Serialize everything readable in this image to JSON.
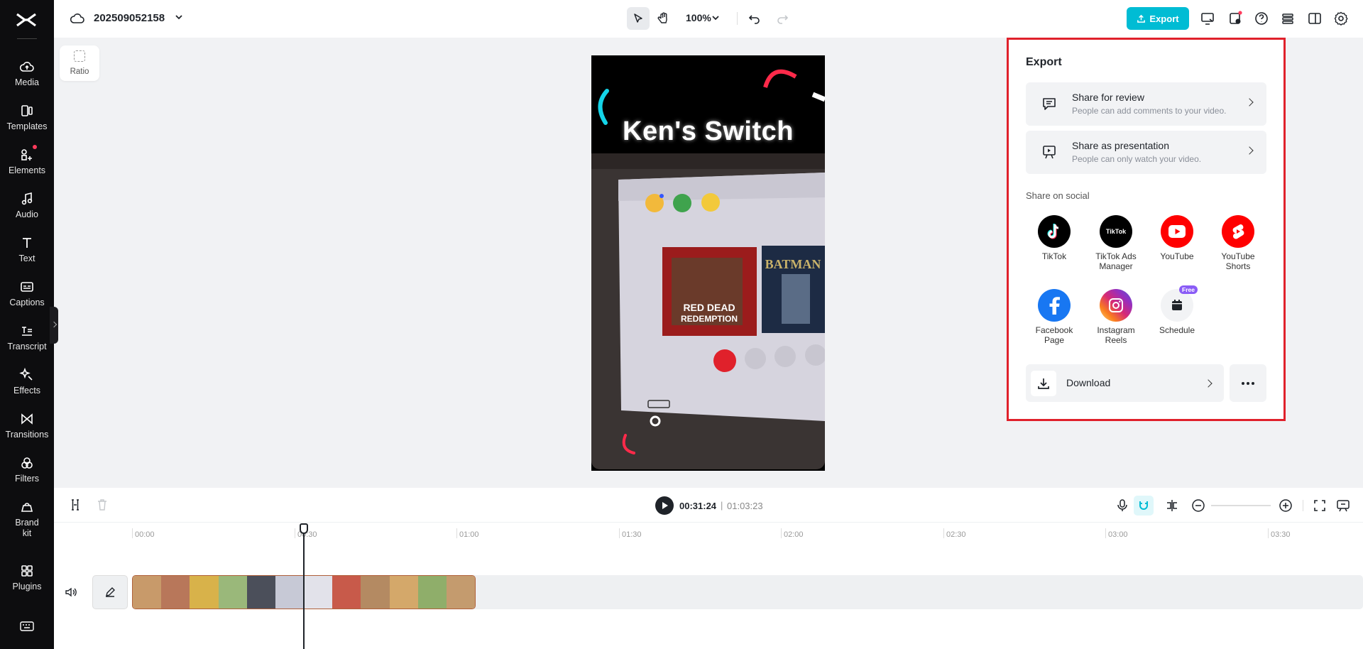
{
  "sidebar": {
    "items": [
      {
        "label": "Media",
        "icon": "cloud-upload-icon"
      },
      {
        "label": "Templates",
        "icon": "templates-icon"
      },
      {
        "label": "Elements",
        "icon": "elements-icon"
      },
      {
        "label": "Audio",
        "icon": "music-note-icon"
      },
      {
        "label": "Text",
        "icon": "text-icon"
      },
      {
        "label": "Captions",
        "icon": "captions-icon"
      },
      {
        "label": "Transcript",
        "icon": "transcript-icon"
      },
      {
        "label": "Effects",
        "icon": "effects-icon"
      },
      {
        "label": "Transitions",
        "icon": "transitions-icon"
      },
      {
        "label": "Filters",
        "icon": "filters-icon"
      },
      {
        "label": "Brand kit",
        "icon": "brand-kit-icon"
      },
      {
        "label": "Plugins",
        "icon": "plugins-icon"
      }
    ]
  },
  "topbar": {
    "project_name": "202509052158",
    "zoom": "100%",
    "export_label": "Export"
  },
  "canvas": {
    "ratio_label": "Ratio",
    "video_title": "Ken's Switch"
  },
  "export_panel": {
    "title": "Export",
    "share_review": {
      "title": "Share for review",
      "desc": "People can add comments to your video."
    },
    "share_presentation": {
      "title": "Share as presentation",
      "desc": "People can only watch your video."
    },
    "social_label": "Share on social",
    "social": [
      {
        "label": "TikTok",
        "color": "#000000"
      },
      {
        "label": "TikTok Ads Manager",
        "color": "#000000",
        "logo_text": "TikTok"
      },
      {
        "label": "YouTube",
        "color": "#ff0000"
      },
      {
        "label": "YouTube Shorts",
        "color": "#ff0000"
      },
      {
        "label": "Facebook Page",
        "color": "#1877f2"
      },
      {
        "label": "Instagram Reels",
        "color": "#d62976"
      },
      {
        "label": "Schedule",
        "color": "#f2f3f5",
        "badge": "Free"
      }
    ],
    "download_label": "Download"
  },
  "timeline": {
    "current_time": "00:31:24",
    "separator": "|",
    "total_time": "01:03:23",
    "ruler": [
      "00:00",
      "00:30",
      "01:00",
      "01:30",
      "02:00",
      "02:30",
      "03:00",
      "03:30"
    ]
  },
  "colors": {
    "accent": "#00bcd4",
    "highlight_border": "#e0212b"
  }
}
